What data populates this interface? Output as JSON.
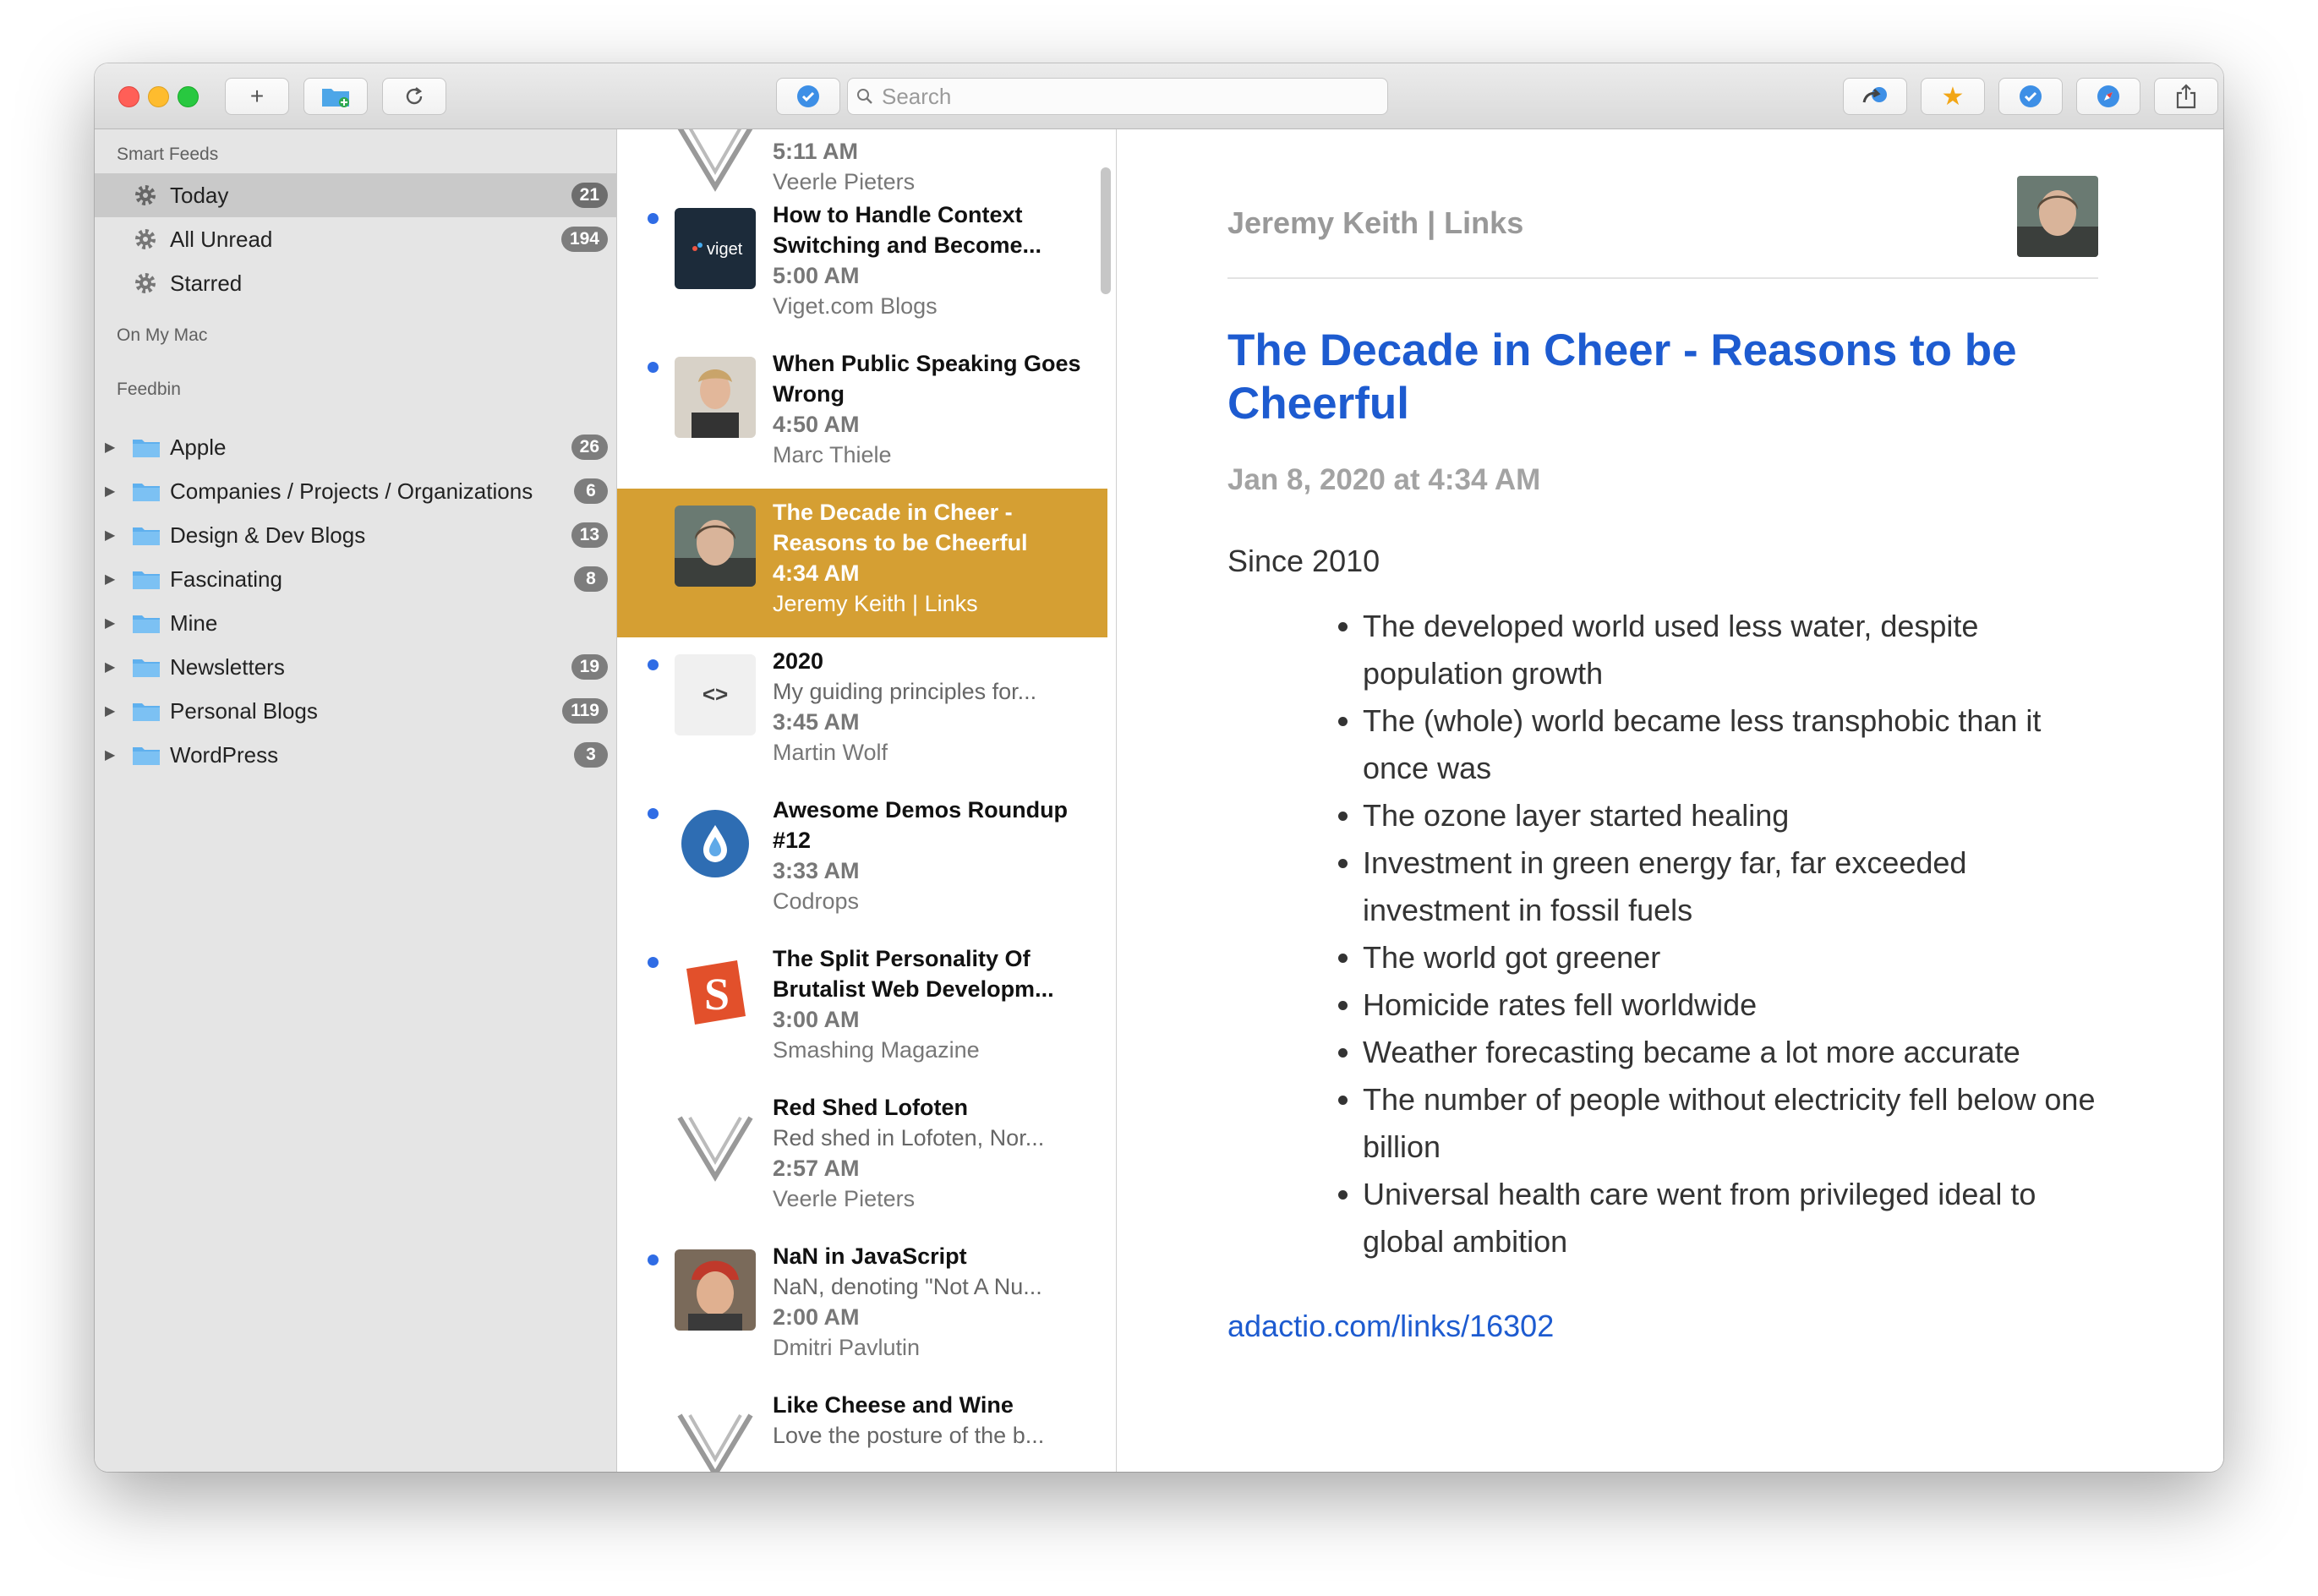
{
  "toolbar": {
    "search_placeholder": "Search"
  },
  "sidebar": {
    "smart_feeds_header": "Smart Feeds",
    "smart_feeds": [
      {
        "label": "Today",
        "count": "21"
      },
      {
        "label": "All Unread",
        "count": "194"
      },
      {
        "label": "Starred",
        "count": ""
      }
    ],
    "on_my_mac_header": "On My Mac",
    "feedbin_header": "Feedbin",
    "folders": [
      {
        "label": "Apple",
        "count": "26"
      },
      {
        "label": "Companies / Projects / Organizations",
        "count": "6"
      },
      {
        "label": "Design & Dev Blogs",
        "count": "13"
      },
      {
        "label": "Fascinating",
        "count": "8"
      },
      {
        "label": "Mine",
        "count": ""
      },
      {
        "label": "Newsletters",
        "count": "19"
      },
      {
        "label": "Personal Blogs",
        "count": "119"
      },
      {
        "label": "WordPress",
        "count": "3"
      }
    ]
  },
  "articles": [
    {
      "title": "",
      "snippet": "",
      "time": "5:11 AM",
      "author": "Veerle Pieters"
    },
    {
      "title": "How to Handle Context Switching and Become...",
      "snippet": "",
      "time": "5:00 AM",
      "author": "Viget.com Blogs",
      "thumb_text": "viget"
    },
    {
      "title": "When Public Speaking Goes Wrong",
      "snippet": "",
      "time": "4:50 AM",
      "author": "Marc Thiele"
    },
    {
      "title": "The Decade in Cheer - Reasons to be Cheerful",
      "snippet": "",
      "time": "4:34 AM",
      "author": "Jeremy Keith | Links"
    },
    {
      "title": "2020",
      "snippet": "My guiding principles for...",
      "time": "3:45 AM",
      "author": "Martin Wolf",
      "thumb_text": "<>"
    },
    {
      "title": "Awesome Demos Roundup #12",
      "snippet": "",
      "time": "3:33 AM",
      "author": "Codrops"
    },
    {
      "title": "The Split Personality Of Brutalist Web Developm...",
      "snippet": "",
      "time": "3:00 AM",
      "author": "Smashing Magazine"
    },
    {
      "title": "Red Shed Lofoten",
      "snippet": "Red shed in Lofoten, Nor...",
      "time": "2:57 AM",
      "author": "Veerle Pieters"
    },
    {
      "title": "NaN in JavaScript",
      "snippet": "NaN, denoting \"Not A Nu...",
      "time": "2:00 AM",
      "author": "Dmitri Pavlutin"
    },
    {
      "title": "Like Cheese and Wine",
      "snippet": "Love the posture of the b...",
      "time": "",
      "author": ""
    }
  ],
  "reader": {
    "feed_name": "Jeremy Keith | Links",
    "title": "The Decade in Cheer - Reasons to be Cheerful",
    "date": "Jan 8, 2020 at 4:34 AM",
    "intro": "Since 2010",
    "bullets": [
      "The developed world used less water, despite population growth",
      "The (whole) world became less transphobic than it once was",
      "The ozone layer started healing",
      "Investment in green energy far, far exceeded investment in fossil fuels",
      "The world got greener",
      "Homicide rates fell worldwide",
      "Weather forecasting became a lot more accurate",
      "The number of people without electricity fell below one billion",
      "Universal health care went from privileged ideal to global ambition"
    ],
    "link": "adactio.com/links/16302"
  },
  "colors": {
    "accent_blue": "#1d5bd0",
    "selected_item": "#d59f33",
    "unread_dot": "#2f6ce5"
  }
}
